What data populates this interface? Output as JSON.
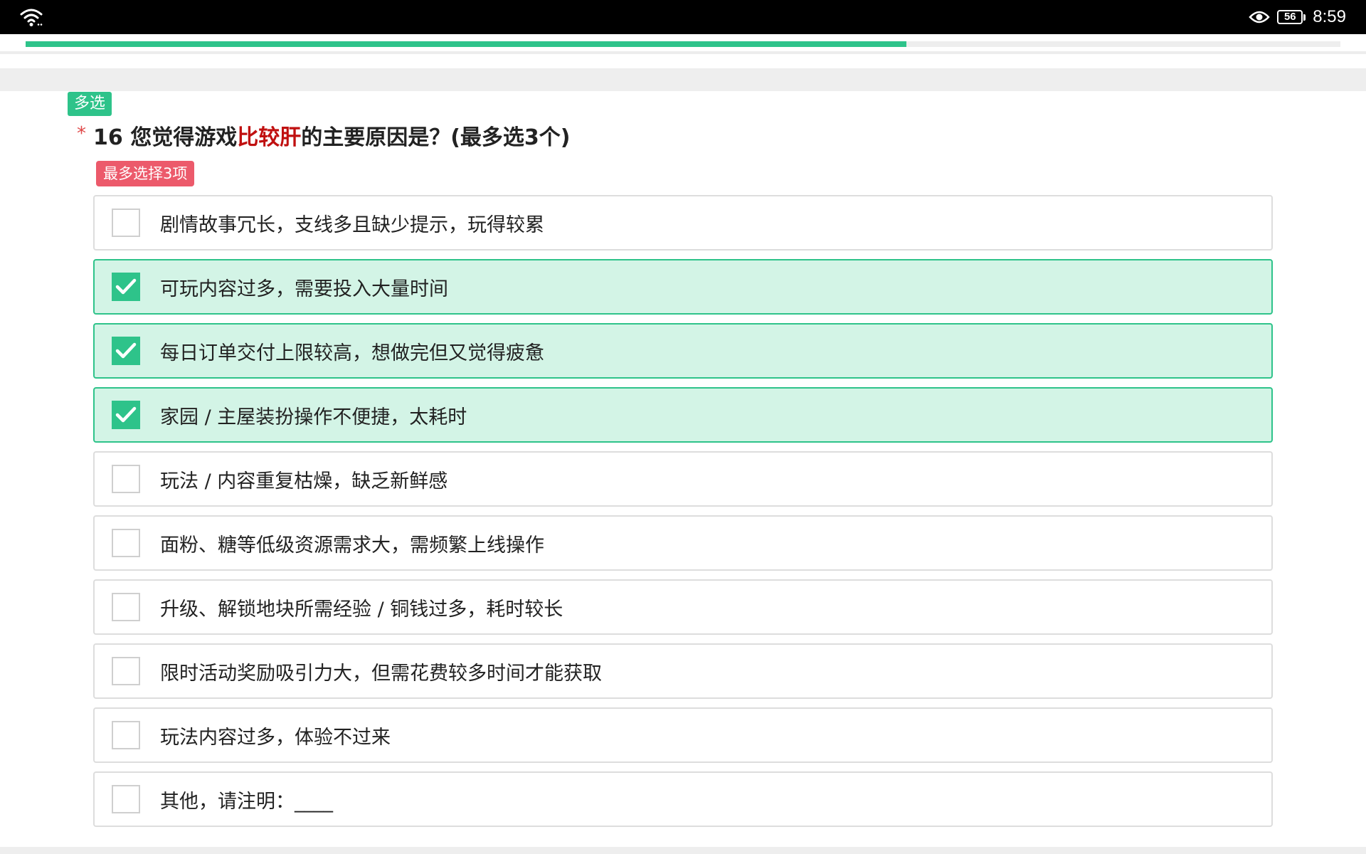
{
  "status_bar": {
    "battery_level": "56",
    "time": "8:59",
    "icons": [
      "wifi-icon",
      "eye-icon",
      "battery-icon"
    ]
  },
  "progress": {
    "fraction": 0.67
  },
  "question": {
    "type_tag": "多选",
    "required_mark": "*",
    "number": "16",
    "text_before": "您觉得游戏",
    "text_highlight": "比较肝",
    "text_after": "的主要原因是？(最多选3个)",
    "max_tag": "最多选择3项"
  },
  "options": [
    {
      "label": "剧情故事冗长，支线多且缺少提示，玩得较累",
      "checked": false
    },
    {
      "label": "可玩内容过多，需要投入大量时间",
      "checked": true
    },
    {
      "label": "每日订单交付上限较高，想做完但又觉得疲惫",
      "checked": true
    },
    {
      "label": "家园 / 主屋装扮操作不便捷，太耗时",
      "checked": true
    },
    {
      "label": "玩法 / 内容重复枯燥，缺乏新鲜感",
      "checked": false
    },
    {
      "label": "面粉、糖等低级资源需求大，需频繁上线操作",
      "checked": false
    },
    {
      "label": "升级、解锁地块所需经验 / 铜钱过多，耗时较长",
      "checked": false
    },
    {
      "label": "限时活动奖励吸引力大，但需花费较多时间才能获取",
      "checked": false
    },
    {
      "label": "玩法内容过多，体验不过来",
      "checked": false
    },
    {
      "label": "其他，请注明：____",
      "checked": false
    }
  ],
  "colors": {
    "accent": "#2ec38a",
    "checked_bg": "#d3f4e6",
    "highlight_text": "#c01010",
    "max_tag_bg": "#ec5a6b"
  }
}
